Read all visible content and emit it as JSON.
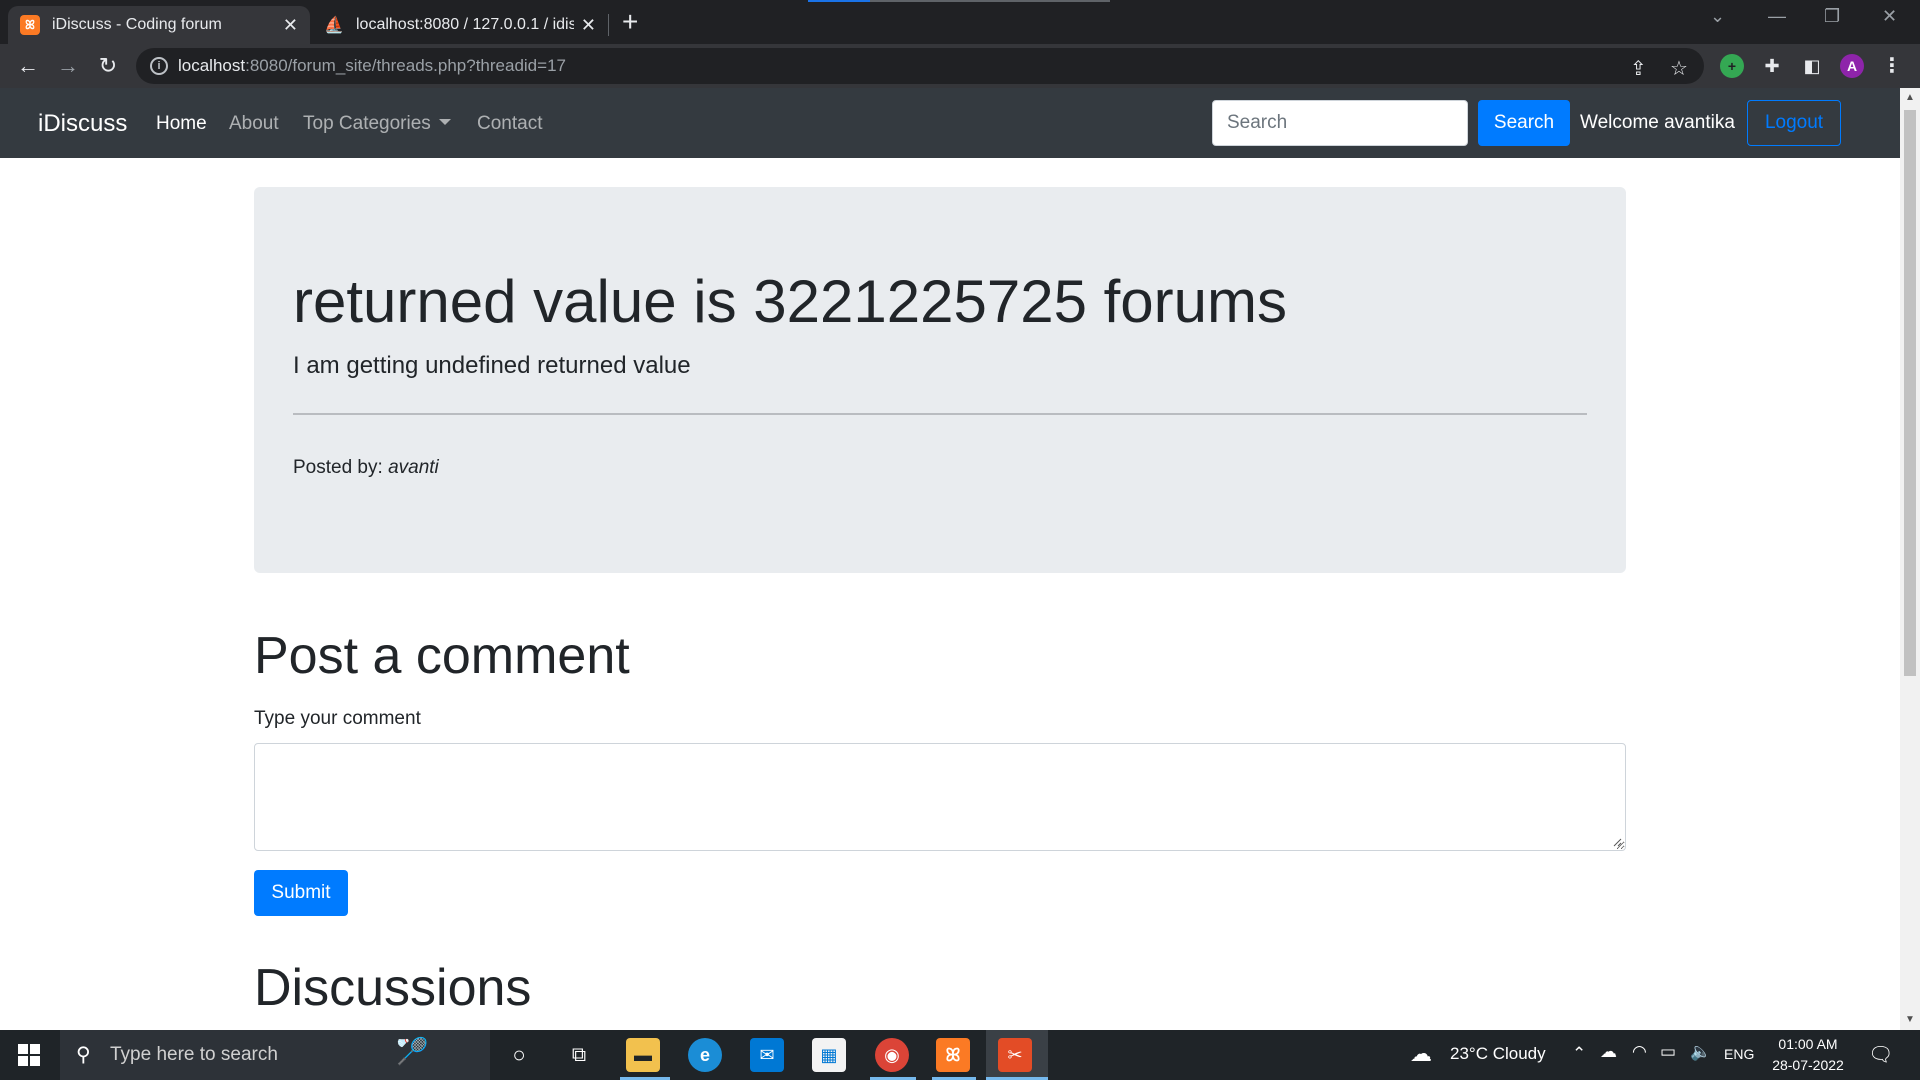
{
  "browser": {
    "tabs": [
      {
        "title": "iDiscuss - Coding forum",
        "active": true
      },
      {
        "title": "localhost:8080 / 127.0.0.1 / idiscu",
        "active": false
      }
    ],
    "new_tab_symbol": "+",
    "url_host": "localhost",
    "url_rest": ":8080/forum_site/threads.php?threadid=17",
    "profile_initial": "A"
  },
  "navbar": {
    "brand": "iDiscuss",
    "links": [
      "Home",
      "About",
      "Top Categories",
      "Contact"
    ],
    "search_placeholder": "Search",
    "search_button": "Search",
    "welcome": "Welcome avantika",
    "logout": "Logout"
  },
  "thread": {
    "title": "returned value is 3221225725 forums",
    "description": "I am getting undefined returned value",
    "posted_by_label": "Posted by:",
    "posted_by_user": "avanti"
  },
  "comment_form": {
    "heading": "Post a comment",
    "label": "Type your comment",
    "value": "",
    "submit": "Submit"
  },
  "discussions": {
    "heading": "Discussions"
  },
  "taskbar": {
    "search_placeholder": "Type here to search",
    "weather": "23°C  Cloudy",
    "language": "ENG",
    "time": "01:00 AM",
    "date": "28-07-2022"
  },
  "colors": {
    "primary": "#007bff",
    "navbar_bg": "#343a40",
    "jumbotron_bg": "#e9ecef"
  }
}
